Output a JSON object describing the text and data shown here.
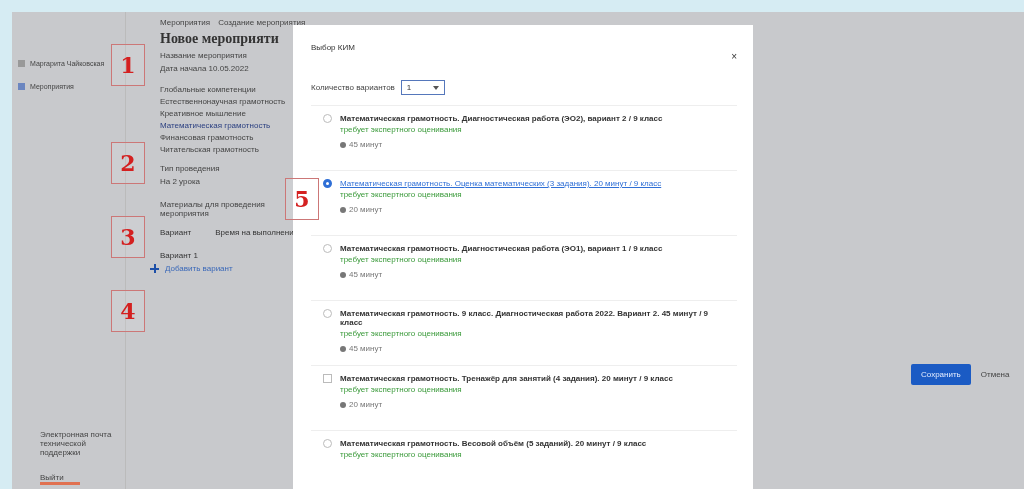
{
  "sidebar": {
    "items": [
      {
        "label": "Маргарита Чайковская",
        "selected": false
      },
      {
        "label": "Мероприятия",
        "selected": true
      }
    ],
    "support": "Электронная почта технической поддержки",
    "logout": "Выйти"
  },
  "breadcrumb": [
    "Мероприятия",
    "Создание мероприятия"
  ],
  "page": {
    "title": "Новое мероприяти",
    "name_label": "Название мероприятия",
    "date": "Дата начала 10.05.2022",
    "competencies": [
      {
        "label": "Глобальные компетенции",
        "selected": false
      },
      {
        "label": "Естественнонаучная грамотность",
        "selected": false
      },
      {
        "label": "Креативное мышление",
        "selected": false
      },
      {
        "label": "Математическая грамотность",
        "selected": true
      },
      {
        "label": "Финансовая грамотность",
        "selected": false
      },
      {
        "label": "Читательская грамотность",
        "selected": false
      }
    ],
    "mode_label": "Тип проведения",
    "mode_value": "На 2 урока",
    "materials_label": "Материалы для проведения мероприятия",
    "columns": [
      "Вариант",
      "Время на выполнени"
    ],
    "rows": [
      "Вариант 1"
    ],
    "add": "Добавить вариант",
    "save": "Сохранить",
    "cancel": "Отмена"
  },
  "modal": {
    "title": "Выбор КИМ",
    "close": "×",
    "count_label": "Количество вариантов",
    "count_value": "1",
    "items": [
      {
        "kind": "radio",
        "selected": false,
        "title": "Математическая грамотность. Диагностическая работа (ЭО2), вариант 2 / 9 класс",
        "note": "требует экспертного оценивания",
        "time": "45 минут"
      },
      {
        "kind": "radio",
        "selected": true,
        "title": "Математическая грамотность. Оценка математических (3 задания). 20 минут / 9 класс",
        "note": "требует экспертного оценивания",
        "time": "20 минут"
      },
      {
        "kind": "radio",
        "selected": false,
        "title": "Математическая грамотность. Диагностическая работа (ЭО1), вариант 1 / 9 класс",
        "note": "требует экспертного оценивания",
        "time": "45 минут"
      },
      {
        "kind": "radio",
        "selected": false,
        "title": "Математическая грамотность. 9 класс. Диагностическая работа 2022. Вариант 2. 45 минут / 9 класс",
        "note": "требует экспертного оценивания",
        "time": "45 минут"
      },
      {
        "kind": "checkbox",
        "selected": false,
        "title": "Математическая грамотность. Тренажёр для занятий (4 задания). 20 минут / 9 класс",
        "note": "требует экспертного оценивания",
        "time": "20 минут"
      },
      {
        "kind": "radio",
        "selected": false,
        "title": "Математическая грамотность. Весовой объём (5 заданий). 20 минут / 9 класс",
        "note": "требует экспертного оценивания"
      }
    ]
  },
  "callouts": [
    "1",
    "2",
    "3",
    "4",
    "5"
  ]
}
